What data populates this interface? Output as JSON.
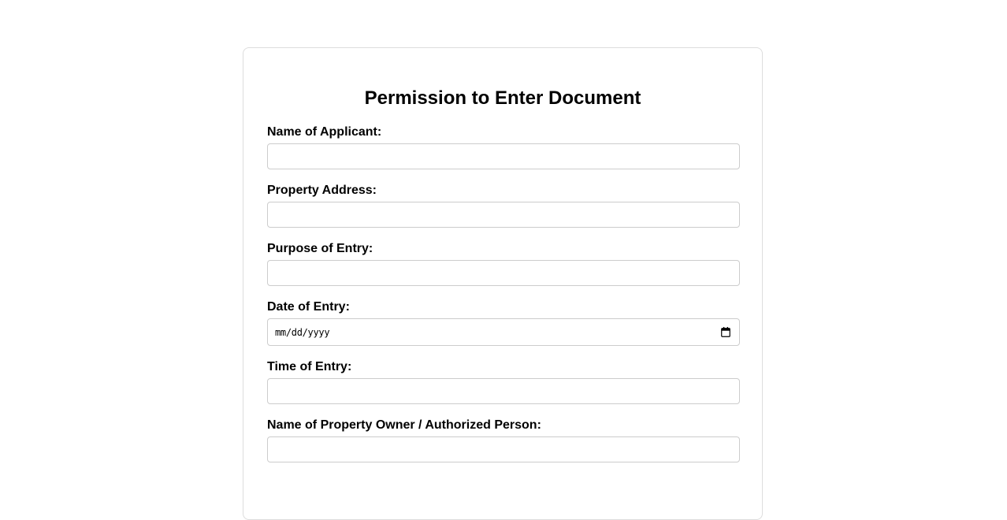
{
  "form": {
    "title": "Permission to Enter Document",
    "fields": [
      {
        "label": "Name of Applicant:",
        "value": "",
        "type": "text"
      },
      {
        "label": "Property Address:",
        "value": "",
        "type": "text"
      },
      {
        "label": "Purpose of Entry:",
        "value": "",
        "type": "text"
      },
      {
        "label": "Date of Entry:",
        "placeholder": "mm/dd/yyyy",
        "type": "date",
        "icon": "calendar-icon"
      },
      {
        "label": "Time of Entry:",
        "value": "",
        "type": "text"
      },
      {
        "label": "Name of Property Owner / Authorized Person:",
        "value": "",
        "type": "text"
      }
    ]
  },
  "colors": {
    "border": "#cccccc",
    "card_border": "#dddddd",
    "background": "#ffffff",
    "text": "#000000"
  }
}
